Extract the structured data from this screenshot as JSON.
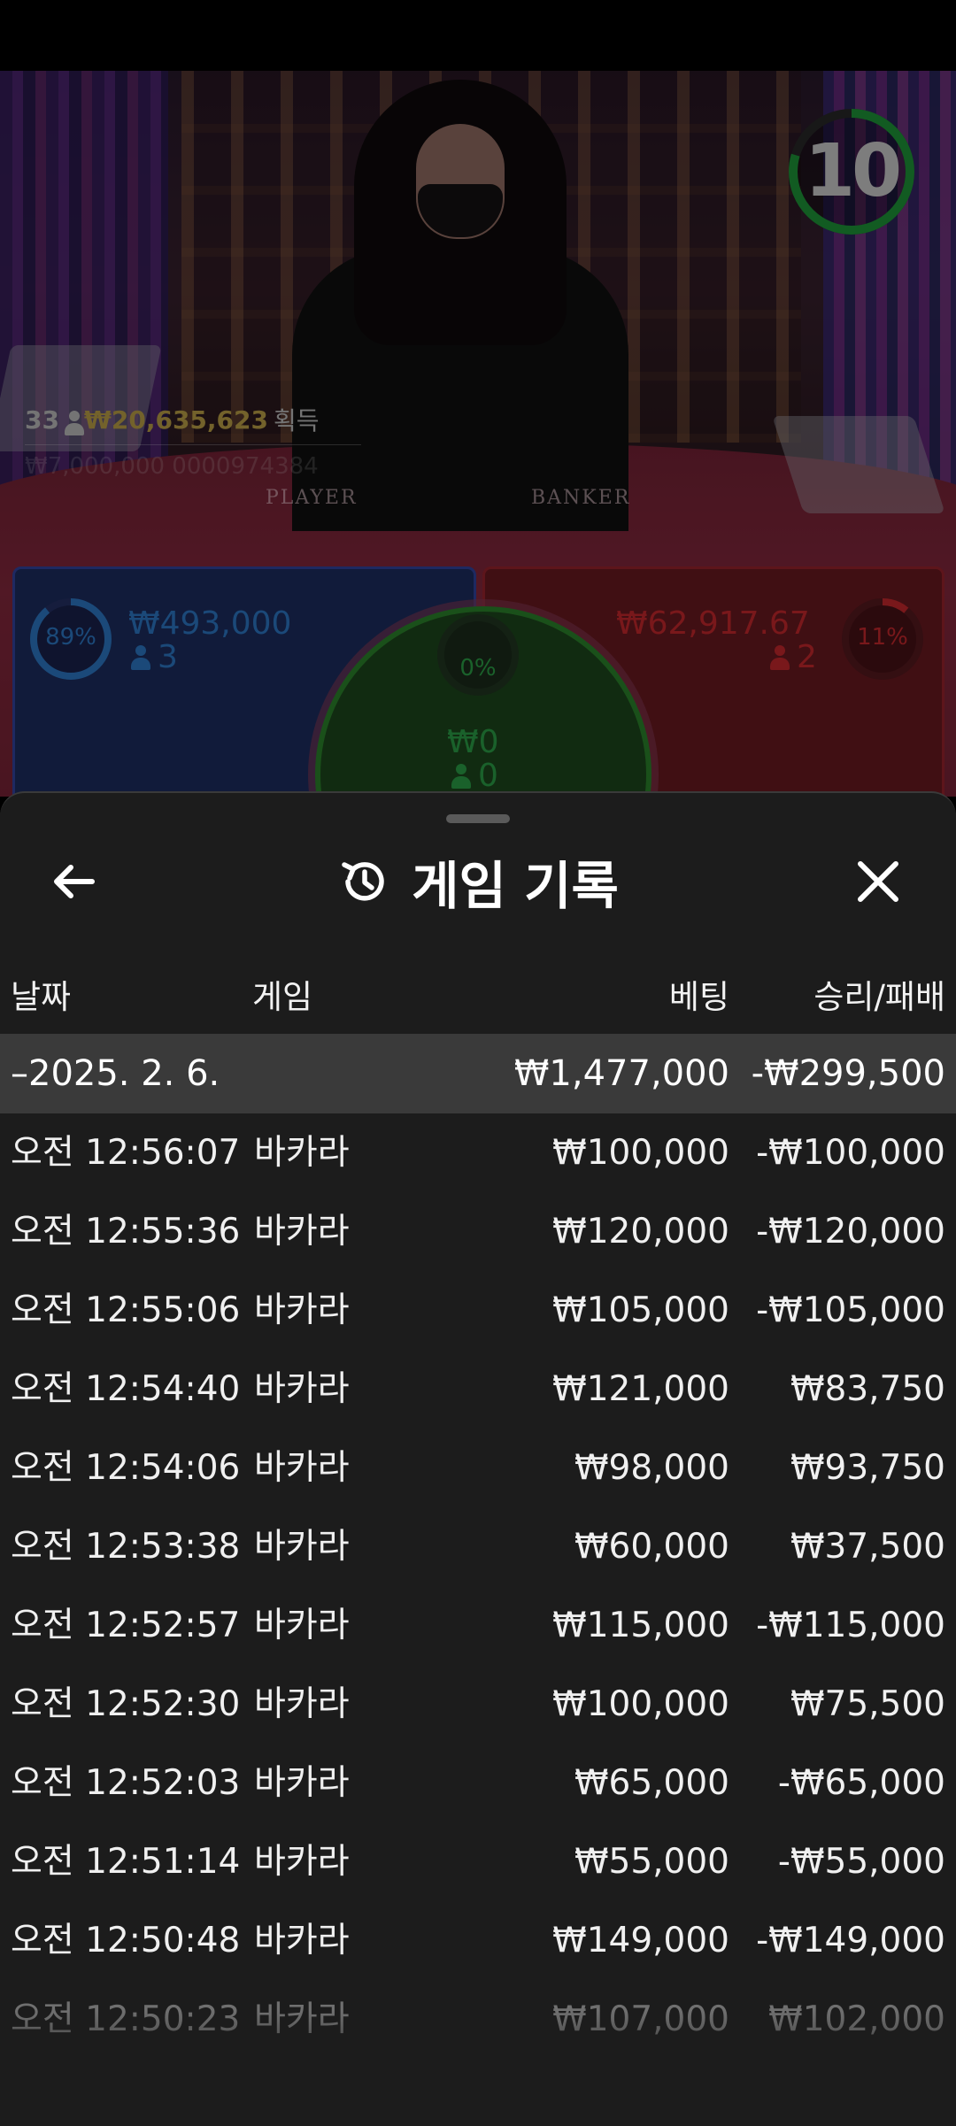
{
  "video": {
    "timer": "10",
    "timer_color": "#1f9e3c",
    "round_count": "33",
    "winnings_amount": "₩20,635,623",
    "winnings_label": "획득",
    "ticker_text": "₩7,000,000 0000974384",
    "felt_player_label": "PLAYER",
    "felt_banker_label": "BANKER",
    "player_bet": {
      "percent": "89%",
      "percent_value": 0.89,
      "amount": "₩493,000",
      "count": "3",
      "color": "#2f7fd1"
    },
    "tie_bet": {
      "percent": "0%",
      "percent_value": 0,
      "amount": "₩0",
      "count": "0",
      "color": "#2ea84a"
    },
    "banker_bet": {
      "percent": "11%",
      "percent_value": 0.11,
      "amount": "₩62,917.67",
      "count": "2",
      "color": "#d12a2f"
    }
  },
  "sheet": {
    "title": "게임 기록",
    "back_icon": "arrow-left-icon",
    "history_icon": "history-clock-icon",
    "close_icon": "close-icon",
    "columns": {
      "date": "날짜",
      "game": "게임",
      "bet": "베팅",
      "win_loss": "승리/패배"
    },
    "date_group": {
      "label": "–2025. 2. 6.",
      "total_bet": "₩1,477,000",
      "total_win_loss": "-₩299,500"
    },
    "rows": [
      {
        "time": "오전 12:56:07",
        "game": "바카라",
        "bet": "₩100,000",
        "win_loss": "-₩100,000"
      },
      {
        "time": "오전 12:55:36",
        "game": "바카라",
        "bet": "₩120,000",
        "win_loss": "-₩120,000"
      },
      {
        "time": "오전 12:55:06",
        "game": "바카라",
        "bet": "₩105,000",
        "win_loss": "-₩105,000"
      },
      {
        "time": "오전 12:54:40",
        "game": "바카라",
        "bet": "₩121,000",
        "win_loss": "₩83,750"
      },
      {
        "time": "오전 12:54:06",
        "game": "바카라",
        "bet": "₩98,000",
        "win_loss": "₩93,750"
      },
      {
        "time": "오전 12:53:38",
        "game": "바카라",
        "bet": "₩60,000",
        "win_loss": "₩37,500"
      },
      {
        "time": "오전 12:52:57",
        "game": "바카라",
        "bet": "₩115,000",
        "win_loss": "-₩115,000"
      },
      {
        "time": "오전 12:52:30",
        "game": "바카라",
        "bet": "₩100,000",
        "win_loss": "₩75,500"
      },
      {
        "time": "오전 12:52:03",
        "game": "바카라",
        "bet": "₩65,000",
        "win_loss": "-₩65,000"
      },
      {
        "time": "오전 12:51:14",
        "game": "바카라",
        "bet": "₩55,000",
        "win_loss": "-₩55,000"
      },
      {
        "time": "오전 12:50:48",
        "game": "바카라",
        "bet": "₩149,000",
        "win_loss": "-₩149,000"
      },
      {
        "time": "오전 12:50:23",
        "game": "바카라",
        "bet": "₩107,000",
        "win_loss": "₩102,000"
      }
    ]
  }
}
